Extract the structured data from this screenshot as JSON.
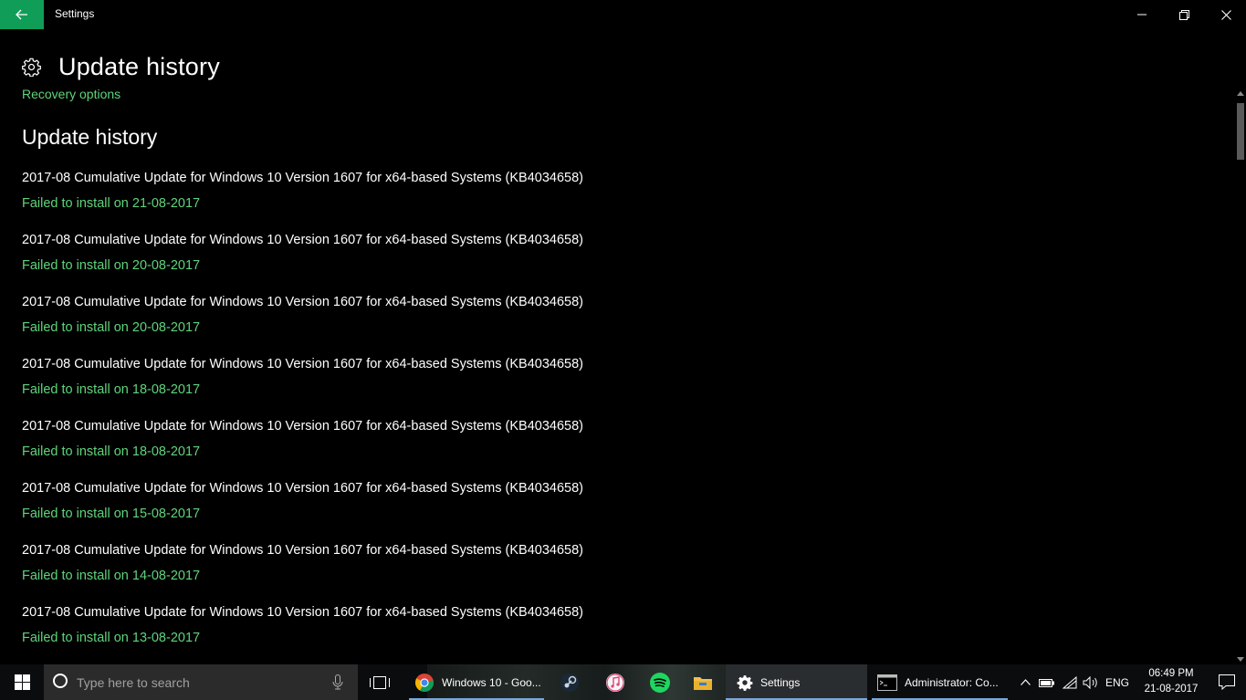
{
  "window": {
    "title": "Settings"
  },
  "header": {
    "title": "Update history",
    "recovery_link": "Recovery options"
  },
  "main": {
    "section_title": "Update history",
    "items": [
      {
        "name": "2017-08 Cumulative Update for Windows 10 Version 1607 for x64-based Systems (KB4034658)",
        "status": "Failed to install on 21-08-2017"
      },
      {
        "name": "2017-08 Cumulative Update for Windows 10 Version 1607 for x64-based Systems (KB4034658)",
        "status": "Failed to install on 20-08-2017"
      },
      {
        "name": "2017-08 Cumulative Update for Windows 10 Version 1607 for x64-based Systems (KB4034658)",
        "status": "Failed to install on 20-08-2017"
      },
      {
        "name": "2017-08 Cumulative Update for Windows 10 Version 1607 for x64-based Systems (KB4034658)",
        "status": "Failed to install on 18-08-2017"
      },
      {
        "name": "2017-08 Cumulative Update for Windows 10 Version 1607 for x64-based Systems (KB4034658)",
        "status": "Failed to install on 18-08-2017"
      },
      {
        "name": "2017-08 Cumulative Update for Windows 10 Version 1607 for x64-based Systems (KB4034658)",
        "status": "Failed to install on 15-08-2017"
      },
      {
        "name": "2017-08 Cumulative Update for Windows 10 Version 1607 for x64-based Systems (KB4034658)",
        "status": "Failed to install on 14-08-2017"
      },
      {
        "name": "2017-08 Cumulative Update for Windows 10 Version 1607 for x64-based Systems (KB4034658)",
        "status": "Failed to install on 13-08-2017"
      }
    ]
  },
  "taskbar": {
    "search_placeholder": "Type here to search",
    "apps": {
      "chrome": "Windows 10 - Goo...",
      "settings": "Settings",
      "cmd": "Administrator: Co..."
    },
    "language": "ENG",
    "time": "06:49 PM",
    "date": "21-08-2017"
  },
  "colors": {
    "accent": "#0f9d58",
    "link": "#5fd47a",
    "background": "#000000",
    "taskbar": "#0a0c0d"
  },
  "icons": [
    "back-arrow-icon",
    "minimize-icon",
    "maximize-icon",
    "close-icon",
    "gear-icon",
    "windows-logo-icon",
    "cortana-icon",
    "microphone-icon",
    "task-view-icon",
    "chrome-icon",
    "steam-icon",
    "itunes-icon",
    "spotify-icon",
    "file-explorer-icon",
    "settings-gear-icon",
    "cmd-icon",
    "chevron-up-icon",
    "battery-icon",
    "wifi-icon",
    "volume-icon",
    "action-center-icon"
  ]
}
